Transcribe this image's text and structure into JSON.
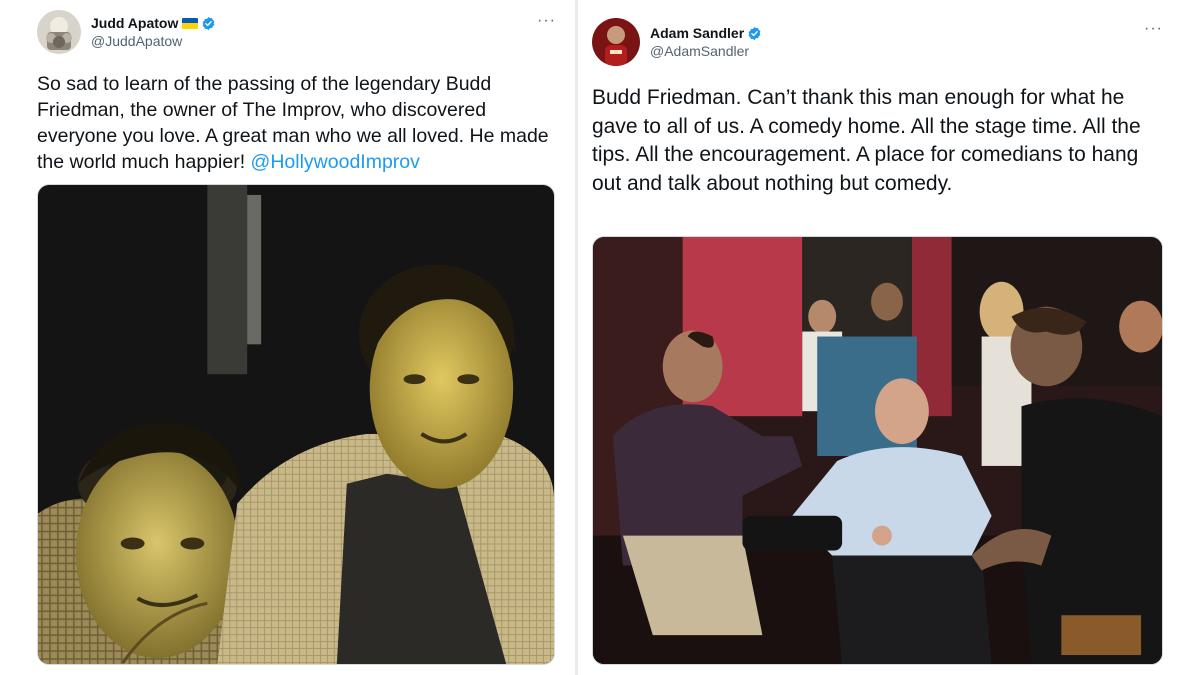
{
  "tweets": [
    {
      "author": {
        "display_name": "Judd Apatow",
        "handle": "@JuddApatow",
        "verified": true,
        "flag_icon": "ukraine-flag-icon"
      },
      "text_main": "So sad to learn of the passing of the legendary Budd Friedman, the owner of The Improv,  who discovered everyone you love.  A great man who we all loved.  He made the world much happier! ",
      "mention": "@HollywoodImprov",
      "more_icon": "···",
      "media": "black-and-white-photo-two-men-sepia-toned"
    },
    {
      "author": {
        "display_name": "Adam Sandler",
        "handle": "@AdamSandler",
        "verified": true
      },
      "text_main": "Budd Friedman. Can’t thank this man enough for what he gave to all of us. A comedy home. All the stage time. All the tips. All the encouragement. A place for comedians to hang out and talk about nothing but comedy.",
      "more_icon": "···",
      "media": "color-photo-comedy-club-group"
    }
  ],
  "colors": {
    "link": "#1d9bf0",
    "verified": "#1d9bf0",
    "secondary_text": "#536471",
    "border": "#cfd9de"
  }
}
